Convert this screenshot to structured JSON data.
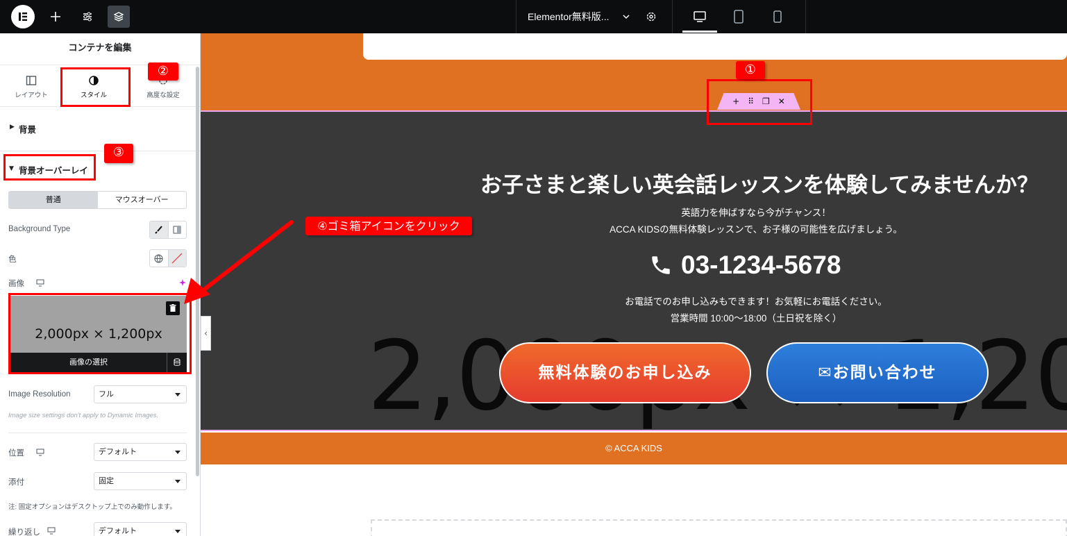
{
  "topbar": {
    "document_title": "Elementor無料版...",
    "device_modes": [
      "desktop",
      "tablet",
      "mobile"
    ]
  },
  "panel": {
    "title": "コンテナを編集",
    "tabs": [
      {
        "label": "レイアウト"
      },
      {
        "label": "スタイル"
      },
      {
        "label": "高度な設定"
      }
    ],
    "section_background": "背景",
    "section_overlay": "背景オーバーレイ",
    "state_normal": "普通",
    "state_hover": "マウスオーバー",
    "bg_type_label": "Background Type",
    "color_label": "色",
    "image_label": "画像",
    "image_placeholder": "2,000px × 1,200px",
    "image_select": "画像の選択",
    "image_resolution_label": "Image Resolution",
    "image_resolution_value": "フル",
    "image_note": "Image size settings don't apply to Dynamic Images.",
    "position_label": "位置",
    "position_value": "デフォルト",
    "attachment_label": "添付",
    "attachment_value": "固定",
    "attachment_note": "注: 固定オプションはデスクトップ上でのみ動作します。",
    "repeat_label": "繰り返し",
    "repeat_value": "デフォルト"
  },
  "annotations": {
    "step1": "①",
    "step2": "②",
    "step3": "③",
    "step4": "④ゴミ箱アイコンをクリック",
    "color": "#ff0000"
  },
  "canvas": {
    "heading": "お子さまと楽しい英会話レッスンを体験してみませんか？",
    "sub1": "英語力を伸ばすなら今がチャンス！",
    "sub2": "ACCA KIDSの無料体験レッスンで、お子様の可能性を広げましょう。",
    "phone": "03-1234-5678",
    "phone_note1": "お電話でのお申し込みもできます！お気軽にお電話ください。",
    "phone_note2": "営業時間 10:00〜18:00（土日祝を除く）",
    "bg_placeholder_text": "2,000px × 1,200px",
    "cta_primary": "無料体験のお申し込み",
    "cta_secondary": "お問い合わせ",
    "footer": "© ACCA KIDS",
    "colors": {
      "orange": "#e17122",
      "dark": "#3a393a",
      "handle": "#f4b5f4"
    }
  }
}
